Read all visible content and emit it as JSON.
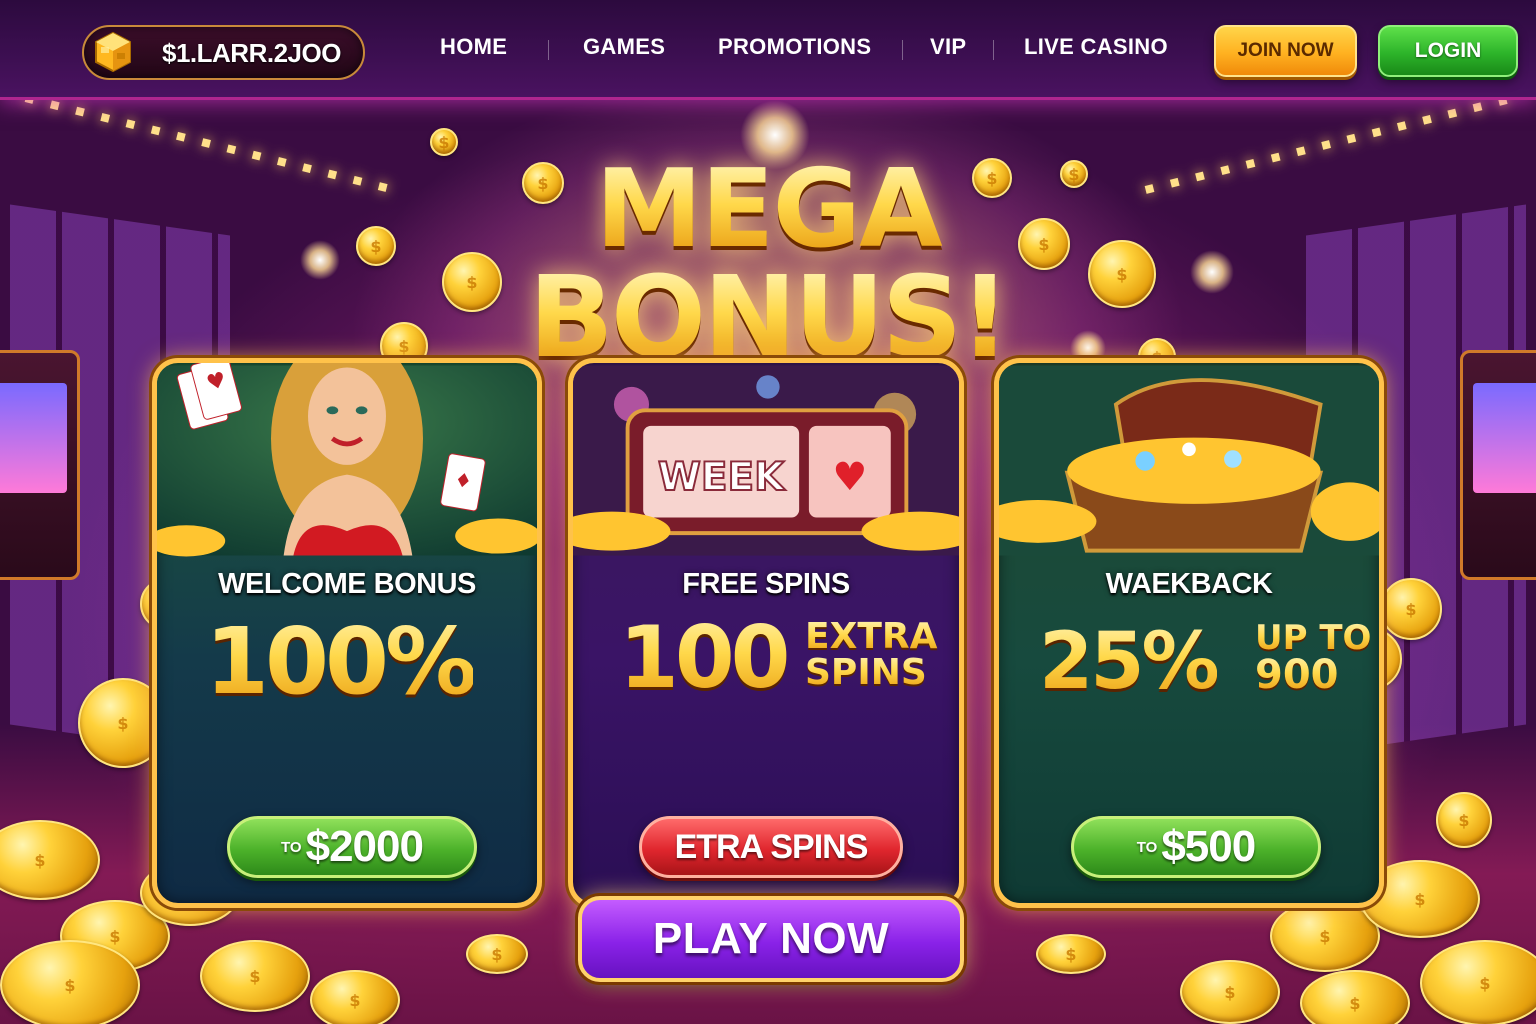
{
  "header": {
    "balance": "$1.LARR.2JOO",
    "nav": [
      "HOME",
      "GAMES",
      "PROMOTIONS",
      "VIP",
      "LIVE CASINO"
    ],
    "join_label": "JOIN NOW",
    "login_label": "LOGIN"
  },
  "hero": {
    "headline_line1": "MEGA",
    "headline_line2": "BONUS!"
  },
  "cards": {
    "welcome": {
      "title": "WELCOME BONUS",
      "value": "100%",
      "button_prefix": "TO",
      "button_label": "$2000"
    },
    "spins": {
      "reel_text": "WEEK",
      "title": "FREE SPINS",
      "value": "100",
      "side_line1": "EXTRA",
      "side_line2": "SPINS",
      "button_label": "ETRA SPINS"
    },
    "cashback": {
      "title": "WAEKBACK",
      "value": "25%",
      "side_line1": "UP TO",
      "side_line2": "900",
      "button_prefix": "TO",
      "button_label": "$500"
    }
  },
  "cta": {
    "label": "PLAY NOW"
  },
  "colors": {
    "header_bg": "#3d0f52",
    "gold": "#ffd040",
    "join_button": "#ffb120",
    "login_button": "#2db42a",
    "play_button": "#8a22e8"
  },
  "icons": {
    "balance": "gold-coin-stack-icon"
  }
}
